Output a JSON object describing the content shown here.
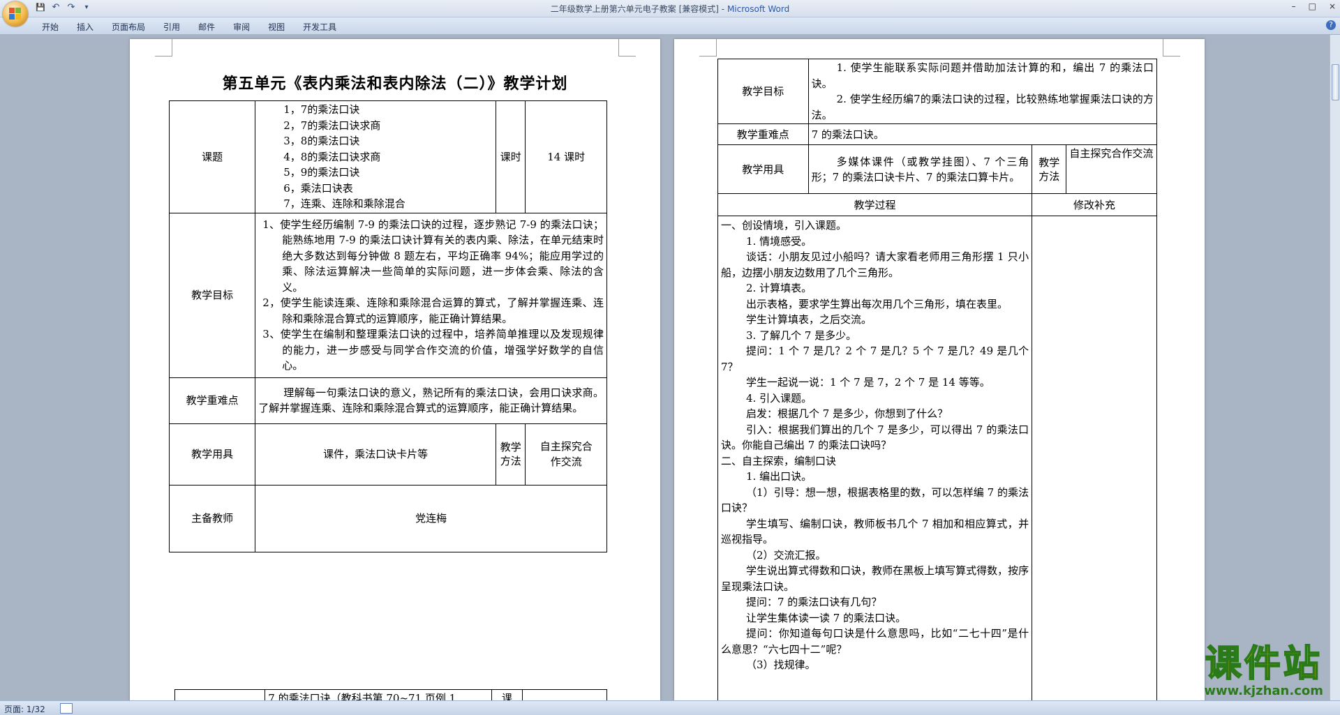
{
  "window": {
    "title": "二年级数学上册第六单元电子教案 [兼容模式]",
    "app_name": "Microsoft Word",
    "controls": [
      "–",
      "□",
      "×"
    ]
  },
  "ribbon": {
    "tabs": [
      "开始",
      "插入",
      "页面布局",
      "引用",
      "邮件",
      "审阅",
      "视图",
      "开发工具"
    ],
    "help": "?"
  },
  "quick_access": {
    "save": "💾",
    "undo": "↶",
    "redo": "↷",
    "more": "▾"
  },
  "page1": {
    "title": "第五单元《表内乘法和表内除法（二）》教学计划",
    "table": {
      "topic_label": "课题",
      "topic_items": [
        "1，7的乘法口诀",
        "2，7的乘法口诀求商",
        "3，8的乘法口诀",
        "4，8的乘法口诀求商",
        "5，9的乘法口诀",
        "6，乘法口诀表",
        "7，连乘、连除和乘除混合"
      ],
      "hours_label": "课时",
      "hours_value": "14 课时",
      "goal_label": "教学目标",
      "goals": [
        "1、使学生经历编制 7-9 的乘法口诀的过程，逐步熟记 7-9 的乘法口诀；能熟练地用 7-9 的乘法口诀计算有关的表内乘、除法，在单元结束时绝大多数达到每分钟做 8 题左右，平均正确率 94%；能应用学过的乘、除法运算解决一些简单的实际问题，进一步体会乘、除法的含义。",
        "2，使学生能读连乘、连除和乘除混合运算的算式，了解并掌握连乘、连除和乘除混合算式的运算顺序，能正确计算结果。",
        "3、使学生在编制和整理乘法口诀的过程中，培养简单推理以及发现规律的能力，进一步感受与同学合作交流的价值，增强学好数学的自信心。"
      ],
      "key_label": "教学重难点",
      "key_value": "理解每一句乘法口诀的意义，熟记所有的乘法口诀，会用口诀求商。了解并掌握连乘、连除和乘除混合算式的运算顺序，能正确计算结果。",
      "tools_label": "教学用具",
      "tools_value": "课件，乘法口诀卡片等",
      "method_label": "教学方法",
      "method_value": "自主探究合作交流",
      "teacher_label": "主备教师",
      "teacher_value": "党连梅"
    },
    "next_table": {
      "topic_value": "7 的乘法口诀（教科书第 70~71 页例 1",
      "hours_label": "课"
    }
  },
  "page2": {
    "goal_label": "教学目标",
    "goals": [
      "1. 使学生能联系实际问题并借助加法计算的和，编出 7 的乘法口诀。",
      "2. 使学生经历编7的乘法口诀的过程，比较熟练地掌握乘法口诀的方法。"
    ],
    "key_label": "教学重难点",
    "key_value": "7 的乘法口诀。",
    "tools_label": "教学用具",
    "tools_value": "多媒体课件（或教学挂图）、7 个三角形；7 的乘法口诀卡片、7 的乘法口算卡片。",
    "method_label": "教学方法",
    "method_value": "自主探究合作交流",
    "process_label": "教学过程",
    "revise_label": "修改补充",
    "process_lines": [
      "一、创设情境，引入课题。",
      "1. 情境感受。",
      "谈话：小朋友见过小船吗？请大家看老师用三角形摆 1 只小船，边摆小朋友边数用了几个三角形。",
      "2. 计算填表。",
      "出示表格，要求学生算出每次用几个三角形，填在表里。",
      "学生计算填表，之后交流。",
      "3. 了解几个 7 是多少。",
      "提问：1 个 7 是几？2 个 7 是几？5 个 7 是几？49 是几个 7？",
      "学生一起说一说：1 个 7 是 7，2 个 7 是 14 等等。",
      "4. 引入课题。",
      "启发：根据几个 7 是多少，你想到了什么？",
      "引入：根据我们算出的几个 7 是多少，可以得出 7 的乘法口诀。你能自己编出 7 的乘法口诀吗？",
      "二、自主探索，编制口诀",
      "1. 编出口诀。",
      "（1）引导：想一想，根据表格里的数，可以怎样编 7 的乘法口诀？",
      "学生填写、编制口诀，教师板书几个 7 相加和相应算式，并巡视指导。",
      "（2）交流汇报。",
      "学生说出算式得数和口诀，教师在黑板上填写算式得数，按序呈现乘法口诀。",
      "提问：7 的乘法口诀有几句？",
      "让学生集体读一读 7 的乘法口诀。",
      "提问：你知道每句口诀是什么意思吗，比如“二七十四”是什么意思？“六七四十二”呢？",
      "（3）找规律。"
    ]
  },
  "status_bar": {
    "page_info": "页面: 1/32"
  },
  "watermark": {
    "brand": "课件站",
    "url": "www.kjzhan.com"
  }
}
